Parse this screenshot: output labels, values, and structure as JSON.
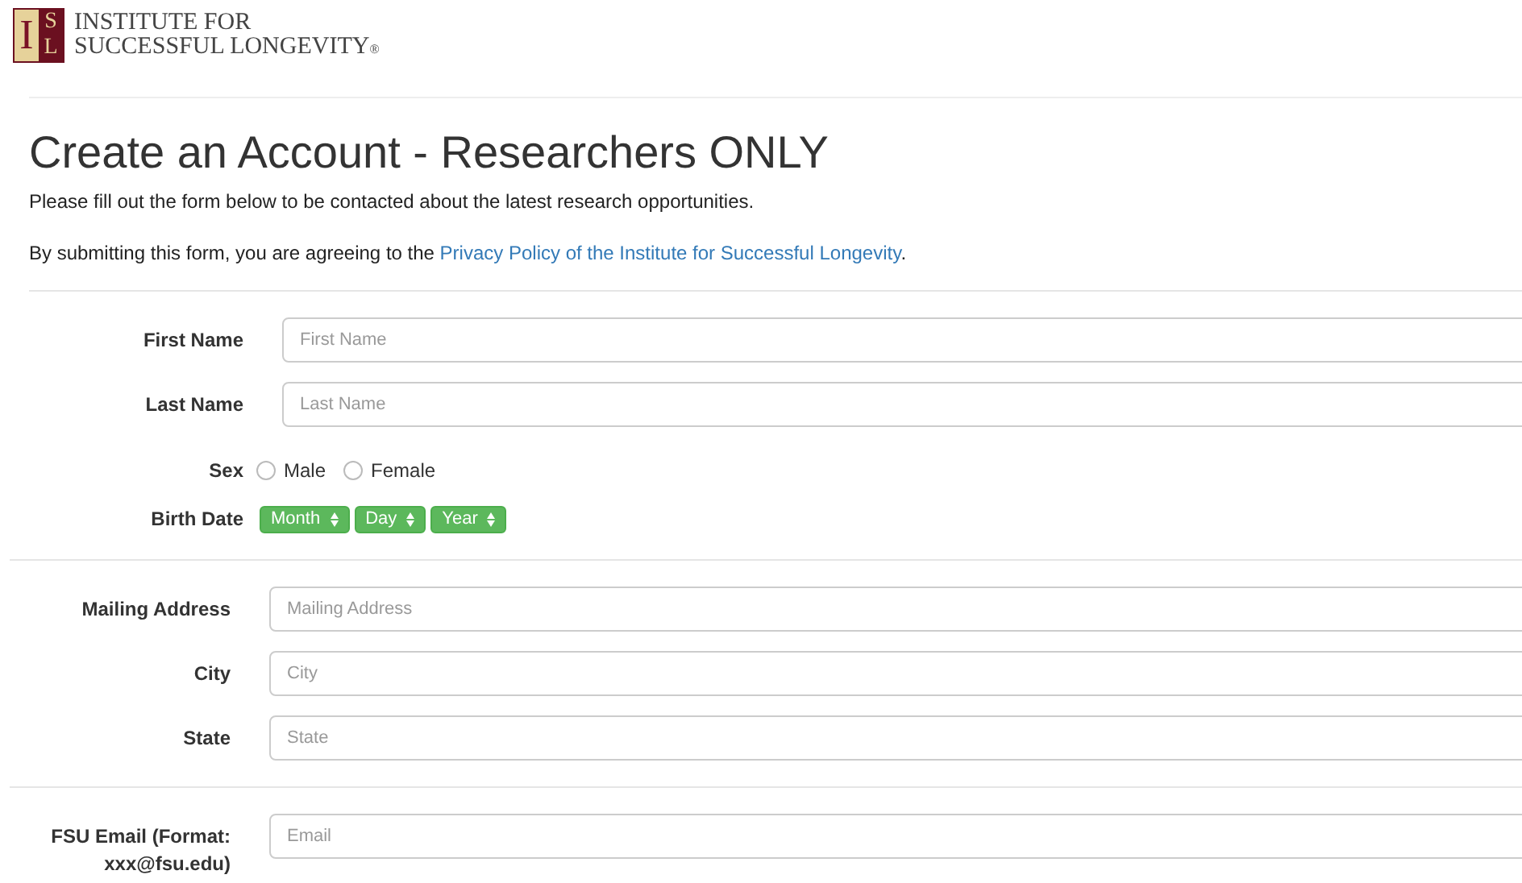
{
  "logo": {
    "letter_left": "I",
    "letter_top": "S",
    "letter_bottom": "L",
    "name_lines": [
      "INSTITUTE FOR",
      "SUCCESSFUL LONGEVITY"
    ],
    "registered": "®"
  },
  "title": "Create an Account - Researchers ONLY",
  "intro": "Please fill out the form below to be contacted about the latest research opportunities.",
  "agreement": {
    "text": "By submitting this form, you are agreeing to the ",
    "link": "Privacy Policy of the Institute for Successful Longevity",
    "end": "."
  },
  "sections": [
    {
      "fields": [
        {
          "kind": "text",
          "label": "First Name",
          "placeholder": "First Name"
        },
        {
          "kind": "text",
          "label": "Last Name",
          "placeholder": "Last Name"
        },
        {
          "kind": "radio",
          "label": "Sex",
          "options": [
            {
              "label": "Male",
              "checked": false
            },
            {
              "label": "Female",
              "checked": false
            }
          ]
        },
        {
          "kind": "date",
          "label": "Birth Date",
          "selects": [
            "Month",
            "Day",
            "Year"
          ]
        }
      ]
    },
    {
      "fields": [
        {
          "kind": "text",
          "label": "Mailing Address",
          "placeholder": "Mailing Address"
        },
        {
          "kind": "text",
          "label": "City",
          "placeholder": "City"
        },
        {
          "kind": "text",
          "label": "State",
          "placeholder": "State"
        }
      ]
    },
    {
      "fields": [
        {
          "kind": "text",
          "label": "FSU Email (Format: xxx@fsu.edu)",
          "placeholder": "Email"
        }
      ]
    }
  ]
}
